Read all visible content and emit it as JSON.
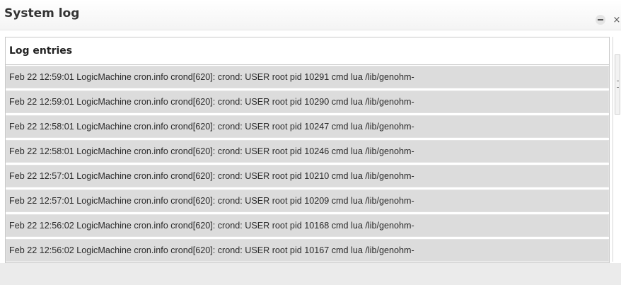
{
  "window": {
    "title": "System log",
    "minimize_icon": "minus-circle-icon",
    "close_label": "×"
  },
  "panel": {
    "title": "Log entries",
    "rows": [
      "Feb 22 12:59:01 LogicMachine cron.info crond[620]: crond: USER root pid 10291 cmd lua /lib/genohm-",
      "Feb 22 12:59:01 LogicMachine cron.info crond[620]: crond: USER root pid 10290 cmd lua /lib/genohm-",
      "Feb 22 12:58:01 LogicMachine cron.info crond[620]: crond: USER root pid 10247 cmd lua /lib/genohm-",
      "Feb 22 12:58:01 LogicMachine cron.info crond[620]: crond: USER root pid 10246 cmd lua /lib/genohm-",
      "Feb 22 12:57:01 LogicMachine cron.info crond[620]: crond: USER root pid 10210 cmd lua /lib/genohm-",
      "Feb 22 12:57:01 LogicMachine cron.info crond[620]: crond: USER root pid 10209 cmd lua /lib/genohm-",
      "Feb 22 12:56:02 LogicMachine cron.info crond[620]: crond: USER root pid 10168 cmd lua /lib/genohm-",
      "Feb 22 12:56:02 LogicMachine cron.info crond[620]: crond: USER root pid 10167 cmd lua /lib/genohm-"
    ]
  }
}
